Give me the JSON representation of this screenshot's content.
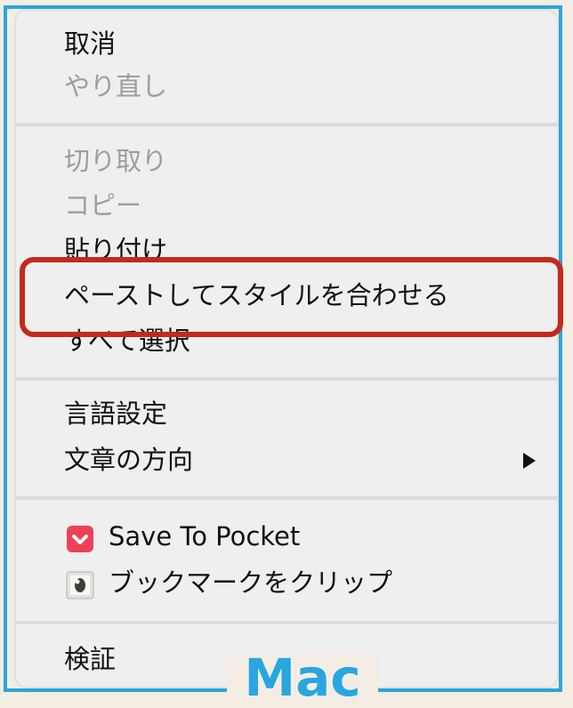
{
  "menu": {
    "groups": [
      {
        "items": [
          {
            "label": "取消",
            "enabled": true
          },
          {
            "label": "やり直し",
            "enabled": false
          }
        ]
      },
      {
        "items": [
          {
            "label": "切り取り",
            "enabled": false
          },
          {
            "label": "コピー",
            "enabled": false
          },
          {
            "label": "貼り付け",
            "enabled": true
          },
          {
            "label": "ペーストしてスタイルを合わせる",
            "enabled": true,
            "highlighted": true
          },
          {
            "label": "すべて選択",
            "enabled": true
          }
        ]
      },
      {
        "items": [
          {
            "label": "言語設定",
            "enabled": true
          },
          {
            "label": "文章の方向",
            "enabled": true,
            "submenu": true
          }
        ]
      },
      {
        "items": [
          {
            "label": "Save To Pocket",
            "enabled": true,
            "icon": "pocket-icon"
          },
          {
            "label": "ブックマークをクリップ",
            "enabled": true,
            "icon": "evernote-icon"
          }
        ]
      },
      {
        "items": [
          {
            "label": "検証",
            "enabled": true
          }
        ]
      }
    ]
  },
  "annotation": {
    "platform_label": "Mac",
    "highlight_color": "#c4291c",
    "frame_color": "#2aa6dc"
  }
}
